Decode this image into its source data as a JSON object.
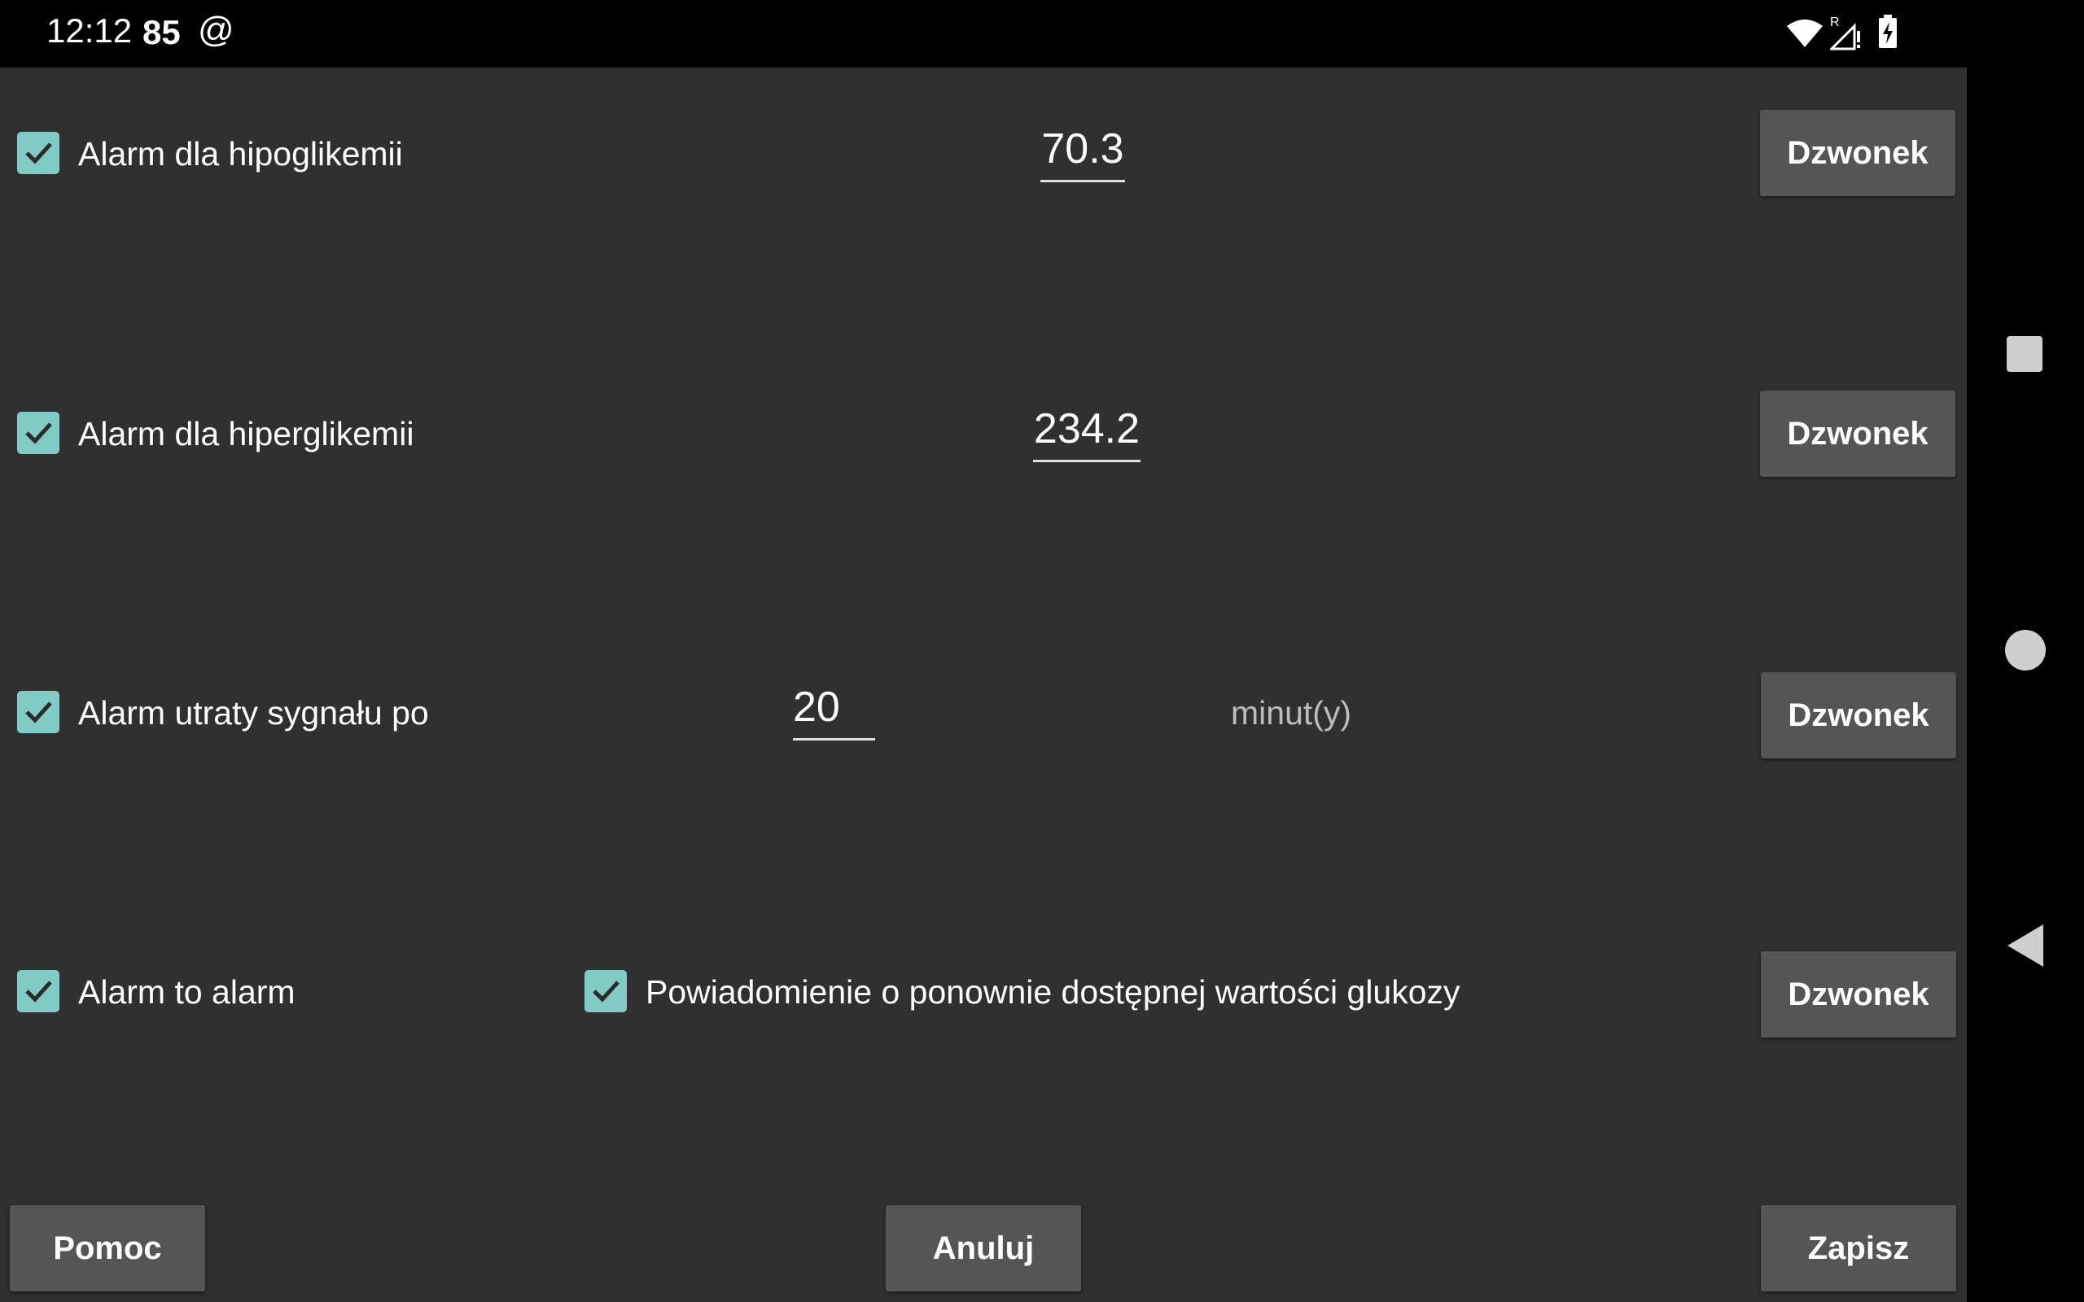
{
  "status_bar": {
    "time": "12:12",
    "notification_number": "85",
    "notification_symbol": "@",
    "icons": [
      "wifi-icon",
      "roaming-no-signal-icon",
      "battery-charging-icon"
    ]
  },
  "alarms": {
    "hypo": {
      "label": "Alarm dla hipoglikemii",
      "checked": true,
      "value": "70.3",
      "button": "Dzwonek"
    },
    "hyper": {
      "label": "Alarm dla hiperglikemii",
      "checked": true,
      "value": "234.2",
      "button": "Dzwonek"
    },
    "signal_loss": {
      "label": "Alarm utraty sygnału po",
      "checked": true,
      "value": "20",
      "unit": "minut(y)",
      "button": "Dzwonek"
    },
    "alarm_to_alarm": {
      "label": "Alarm to alarm",
      "checked": true
    },
    "glucose_available": {
      "label": "Powiadomienie o ponownie dostępnej wartości glukozy",
      "checked": true,
      "button": "Dzwonek"
    }
  },
  "footer": {
    "help": "Pomoc",
    "cancel": "Anuluj",
    "save": "Zapisz"
  },
  "nav_bar": {
    "icons": [
      "recents-icon",
      "home-icon",
      "back-icon"
    ]
  },
  "colors": {
    "accent": "#80cbc4",
    "background": "#303030",
    "button": "#555555"
  }
}
